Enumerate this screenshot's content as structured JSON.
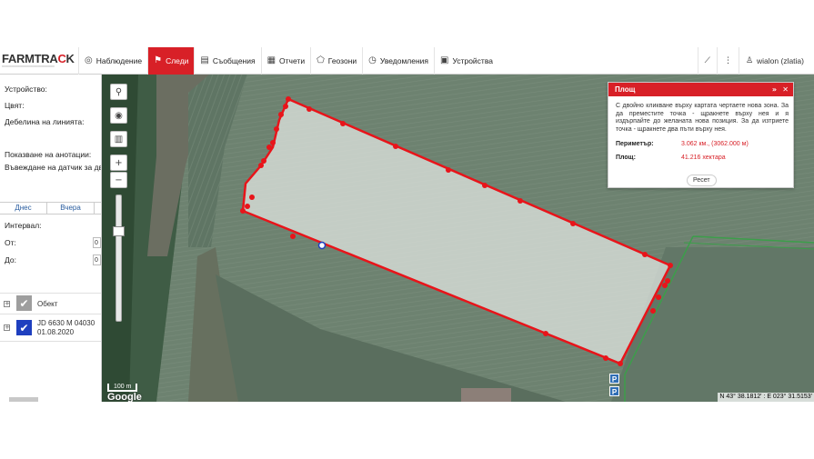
{
  "logo": {
    "brand_a": "FARMTRA",
    "brand_b": "C",
    "brand_c": "K",
    "tagline": ""
  },
  "nav": {
    "items": [
      {
        "label": "Наблюдение",
        "icon": "globe-icon"
      },
      {
        "label": "Следи",
        "icon": "flag-icon",
        "active": true
      },
      {
        "label": "Съобщения",
        "icon": "messages-icon"
      },
      {
        "label": "Отчети",
        "icon": "reports-icon"
      },
      {
        "label": "Геозони",
        "icon": "geofence-icon"
      },
      {
        "label": "Уведомления",
        "icon": "notifications-icon"
      },
      {
        "label": "Устройства",
        "icon": "vehicle-icon"
      }
    ],
    "user": "wialon (zlatia)"
  },
  "sidebar": {
    "device_label": "Устройство:",
    "color_label": "Цвят:",
    "line_width_label": "Дебелина на линията:",
    "annotations_label": "Показване на анотации:",
    "sensor_label": "Въвеждане на датчик за дви",
    "tab_today": "Днес",
    "tab_yesterday": "Вчера",
    "interval_label": "Интервал:",
    "from_label": "От:",
    "to_label": "До:",
    "from_value": "0",
    "to_value": "0",
    "units": [
      {
        "name": "Обект",
        "subtitle": "",
        "checked_color": "#9e9e9e"
      },
      {
        "name": "JD 6630 M 04030",
        "subtitle": "01.08.2020",
        "checked_color": "#1e3fbf"
      }
    ]
  },
  "map": {
    "scale_label": "100 m",
    "attribution": "Google",
    "coords": "N 43° 38.1812' : E 023° 31.5153'",
    "parking_label": "P",
    "polygon_color": "#e8141a"
  },
  "area_panel": {
    "title": "Площ",
    "description": "С двойно кликване върху картата чертаете нова зона. За да преместите точка - щракнете върху нея и я издърпайте до желаната нова позиция. За да изтриете точка - щракнете два пъти върху нея.",
    "perimeter_label": "Периметър:",
    "perimeter_value": "3.062 км., (3062.000 м)",
    "area_label": "Площ:",
    "area_value": "41.216 хектара",
    "reset_label": "Ресет"
  }
}
